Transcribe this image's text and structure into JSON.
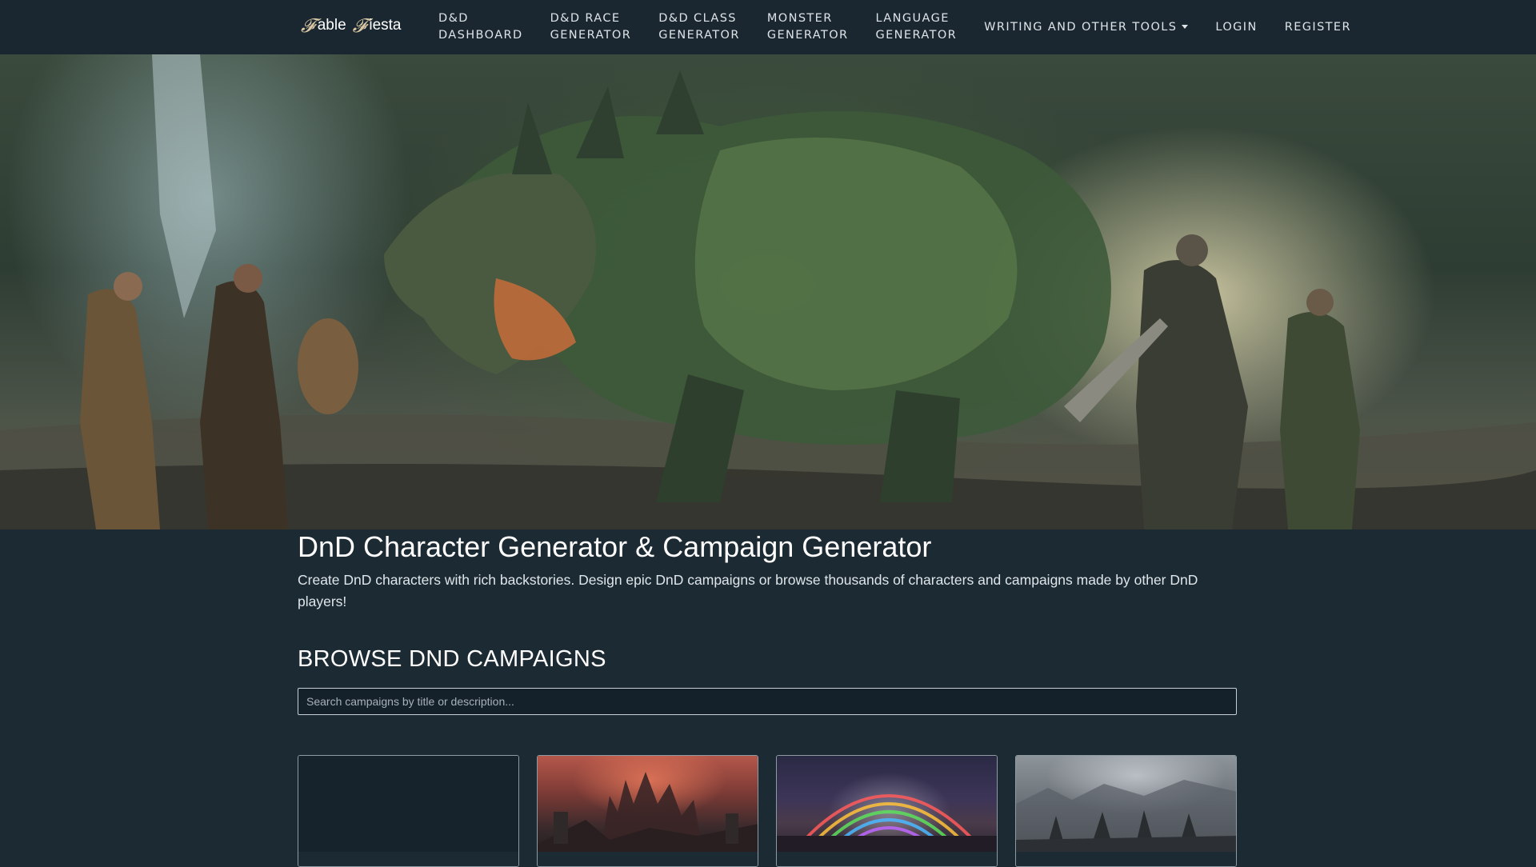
{
  "brand": {
    "glyph": "𝓕",
    "word1": "able",
    "word2": "iesta"
  },
  "nav": {
    "items": [
      {
        "label": "D&D\nDASHBOARD"
      },
      {
        "label": "D&D RACE\nGENERATOR"
      },
      {
        "label": "D&D CLASS\nGENERATOR"
      },
      {
        "label": "MONSTER\nGENERATOR"
      },
      {
        "label": "LANGUAGE\nGENERATOR"
      },
      {
        "label": "WRITING AND OTHER TOOLS"
      },
      {
        "label": "LOGIN"
      },
      {
        "label": "REGISTER"
      }
    ]
  },
  "hero": {
    "image": "dragon-battle-banner"
  },
  "main": {
    "title": "DnD Character Generator & Campaign Generator",
    "description": "Create DnD characters with rich backstories. Design epic DnD campaigns or browse thousands of characters and campaigns made by other DnD players!"
  },
  "campaigns": {
    "heading": "BROWSE DND CAMPAIGNS",
    "search_placeholder": "Search campaigns by title or description...",
    "cards": [
      {
        "image": "empty-thumbnail"
      },
      {
        "image": "red-castle-city-thumbnail"
      },
      {
        "image": "rainbow-magic-battle-thumbnail"
      },
      {
        "image": "grey-warriors-thumbnail"
      }
    ]
  },
  "colors": {
    "page_background": "#1c2a33",
    "navbar_background": "#1a2730",
    "text": "#ffffff"
  }
}
